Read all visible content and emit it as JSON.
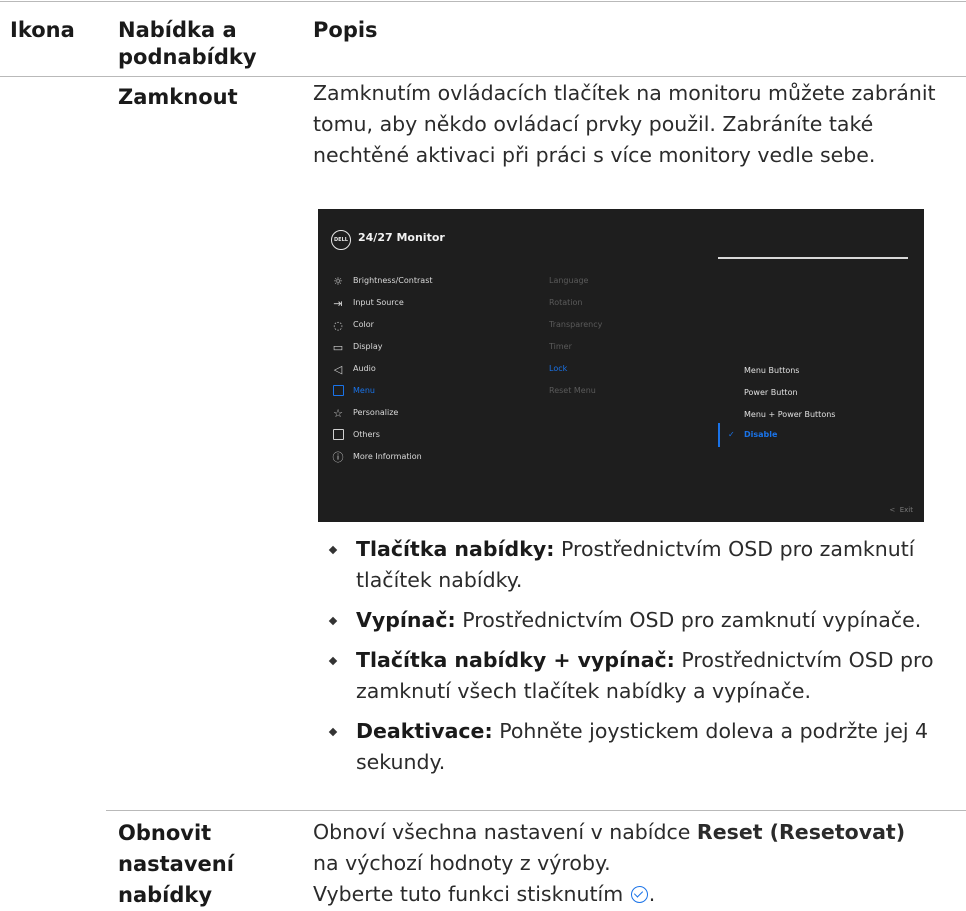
{
  "table": {
    "headers": {
      "icon": "Ikona",
      "menu": "Nabídka a podnabídky",
      "description": "Popis"
    }
  },
  "lock_row": {
    "label": "Zamknout",
    "description": "Zamknutím ovládacích tlačítek na monitoru můžete zabránit tomu, aby někdo ovládací prvky použil. Zabráníte také nechtěné aktivaci při práci s více monitory vedle sebe.",
    "bullets": [
      {
        "term": "Tlačítka nabídky:",
        "text": "Prostřednictvím OSD pro zamknutí tlačítek nabídky."
      },
      {
        "term": "Vypínač:",
        "text": "Prostřednictvím OSD pro zamknutí vypínače."
      },
      {
        "term": "Tlačítka nabídky + vypínač:",
        "text": "Prostřednictvím OSD pro zamknutí všech tlačítek nabídky a vypínače."
      },
      {
        "term": "Deaktivace:",
        "text": "Pohněte joystickem doleva a podržte jej 4 sekundy."
      }
    ]
  },
  "osd": {
    "logo_text": "DELL",
    "title": "24/27 Monitor",
    "menu_items": [
      {
        "icon": "brightness-icon",
        "label": "Brightness/Contrast"
      },
      {
        "icon": "input-source-icon",
        "label": "Input Source"
      },
      {
        "icon": "color-icon",
        "label": "Color"
      },
      {
        "icon": "display-icon",
        "label": "Display"
      },
      {
        "icon": "audio-icon",
        "label": "Audio"
      },
      {
        "icon": "menu-icon",
        "label": "Menu",
        "active": true
      },
      {
        "icon": "personalize-icon",
        "label": "Personalize"
      },
      {
        "icon": "others-icon",
        "label": "Others"
      },
      {
        "icon": "info-icon",
        "label": "More Information"
      }
    ],
    "submenu": [
      "Language",
      "Rotation",
      "Transparency",
      "Timer",
      "Lock",
      "Reset Menu"
    ],
    "submenu_active": "Lock",
    "options": [
      "Menu Buttons",
      "Power Button",
      "Menu + Power Buttons",
      "Disable"
    ],
    "selected_option": "Disable",
    "exit_label": "Exit",
    "accent_color": "#1a73e8"
  },
  "reset_row": {
    "label": "Obnovit nastavení nabídky",
    "label_lines": [
      "Obnovit",
      "nastavení",
      "nabídky"
    ],
    "line1_pre": "Obnoví všechna nastavení v nabídce",
    "line1_bold": "Reset (Resetovat)",
    "line2": "na výchozí hodnoty z výroby.",
    "line3_pre": "Vyberte tuto funkci stisknutím",
    "line3_post": ".",
    "select_icon": "check-circle-icon"
  }
}
